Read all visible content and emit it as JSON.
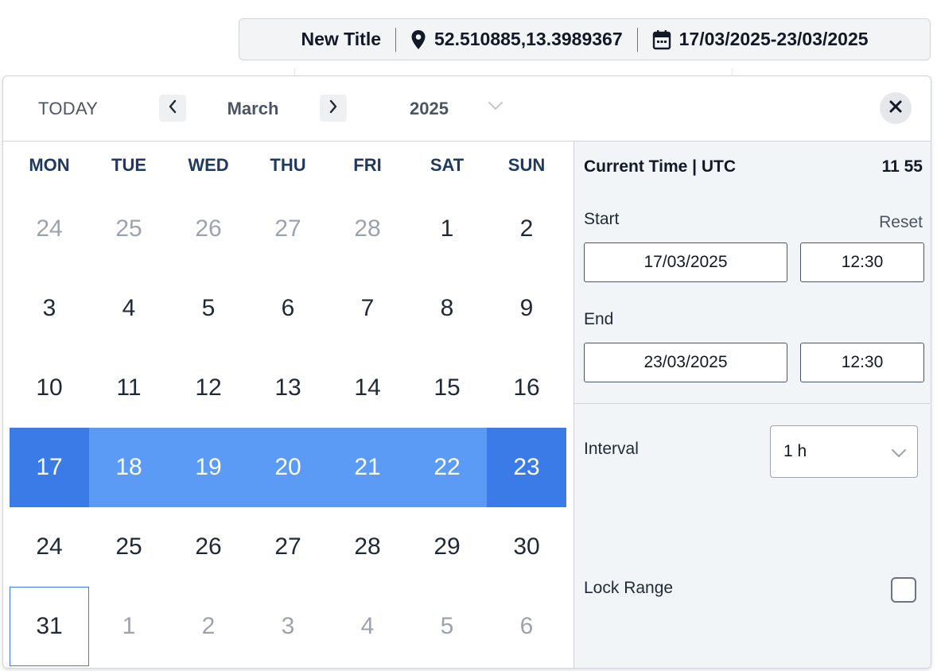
{
  "topbar": {
    "title": "New Title",
    "location": "52.510885,13.3989367",
    "date_range": "17/03/2025-23/03/2025",
    "icons": [
      "map-pin-icon",
      "calendar-icon"
    ]
  },
  "header": {
    "today_label": "TODAY",
    "month": "March",
    "year": "2025",
    "icons": [
      "chevron-left-icon",
      "chevron-right-icon",
      "chevron-down-icon",
      "close-icon"
    ]
  },
  "calendar": {
    "weekdays": [
      "MON",
      "TUE",
      "WED",
      "THU",
      "FRI",
      "SAT",
      "SUN"
    ],
    "weeks": [
      [
        {
          "d": "24",
          "s": "muted"
        },
        {
          "d": "25",
          "s": "muted"
        },
        {
          "d": "26",
          "s": "muted"
        },
        {
          "d": "27",
          "s": "muted"
        },
        {
          "d": "28",
          "s": "muted"
        },
        {
          "d": "1",
          "s": ""
        },
        {
          "d": "2",
          "s": ""
        }
      ],
      [
        {
          "d": "3",
          "s": ""
        },
        {
          "d": "4",
          "s": ""
        },
        {
          "d": "5",
          "s": ""
        },
        {
          "d": "6",
          "s": ""
        },
        {
          "d": "7",
          "s": ""
        },
        {
          "d": "8",
          "s": ""
        },
        {
          "d": "9",
          "s": ""
        }
      ],
      [
        {
          "d": "10",
          "s": ""
        },
        {
          "d": "11",
          "s": ""
        },
        {
          "d": "12",
          "s": ""
        },
        {
          "d": "13",
          "s": ""
        },
        {
          "d": "14",
          "s": ""
        },
        {
          "d": "15",
          "s": ""
        },
        {
          "d": "16",
          "s": ""
        }
      ],
      [
        {
          "d": "17",
          "s": "edge"
        },
        {
          "d": "18",
          "s": "range"
        },
        {
          "d": "19",
          "s": "range"
        },
        {
          "d": "20",
          "s": "range"
        },
        {
          "d": "21",
          "s": "range"
        },
        {
          "d": "22",
          "s": "range"
        },
        {
          "d": "23",
          "s": "edge"
        }
      ],
      [
        {
          "d": "24",
          "s": ""
        },
        {
          "d": "25",
          "s": ""
        },
        {
          "d": "26",
          "s": ""
        },
        {
          "d": "27",
          "s": ""
        },
        {
          "d": "28",
          "s": ""
        },
        {
          "d": "29",
          "s": ""
        },
        {
          "d": "30",
          "s": ""
        }
      ],
      [
        {
          "d": "31",
          "s": "today-mark"
        },
        {
          "d": "1",
          "s": "muted"
        },
        {
          "d": "2",
          "s": "muted"
        },
        {
          "d": "3",
          "s": "muted"
        },
        {
          "d": "4",
          "s": "muted"
        },
        {
          "d": "5",
          "s": "muted"
        },
        {
          "d": "6",
          "s": "muted"
        }
      ]
    ]
  },
  "panel": {
    "current_time_label": "Current Time | UTC",
    "current_time_value": "11 55",
    "start_label": "Start",
    "reset_label": "Reset",
    "start_date": "17/03/2025",
    "start_time": "12:30",
    "end_label": "End",
    "end_date": "23/03/2025",
    "end_time": "12:30",
    "interval_label": "Interval",
    "interval_value": "1 h",
    "lock_range_label": "Lock Range",
    "lock_range_checked": false
  },
  "colors": {
    "range": "#5b9bf5",
    "range_edge": "#3a7be8",
    "weekday": "#1e3a5f",
    "panel_bg": "#f1f5f8"
  }
}
